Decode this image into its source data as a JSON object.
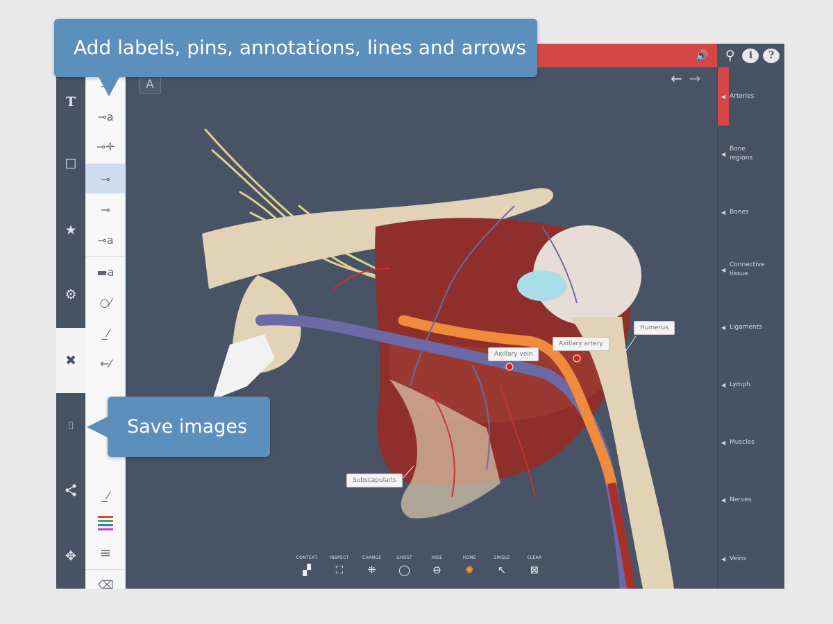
{
  "callouts": {
    "top": "Add labels, pins, annotations, lines and arrows",
    "bottom": "Save images"
  },
  "top_bar": {
    "accent_color": "#d54646",
    "icons": [
      "speaker-icon",
      "search-icon",
      "info-icon",
      "help-icon"
    ]
  },
  "left_rail": {
    "items": [
      {
        "icon": "text-icon",
        "glyph": "T"
      },
      {
        "icon": "square-icon",
        "glyph": "☐"
      },
      {
        "icon": "star-icon",
        "glyph": "★"
      },
      {
        "icon": "gear-icon",
        "glyph": "⚙"
      },
      {
        "icon": "annotation-tools-icon",
        "glyph": "✖",
        "active": true
      },
      {
        "icon": "camera-icon",
        "glyph": "📷"
      },
      {
        "icon": "share-icon",
        "glyph": "⋖"
      },
      {
        "icon": "move-icon",
        "glyph": "✥"
      }
    ]
  },
  "tools": {
    "items": [
      {
        "icon": "pin-remove-icon",
        "glyph": "⊸"
      },
      {
        "icon": "pin-label-icon",
        "glyph": "⊸a"
      },
      {
        "icon": "pin-move-icon",
        "glyph": "⊸✛"
      },
      {
        "icon": "pin-selected-icon",
        "glyph": "⊸",
        "selected": true
      },
      {
        "icon": "pin-delete-icon",
        "glyph": "⊸"
      },
      {
        "icon": "pin-text-icon",
        "glyph": "⊸a"
      },
      {
        "icon": "label-text-icon",
        "glyph": "▬a"
      },
      {
        "icon": "circle-line-icon",
        "glyph": "○⁄"
      },
      {
        "icon": "line-icon",
        "glyph": "_⁄"
      },
      {
        "icon": "arrow-line-icon",
        "glyph": "←⁄"
      },
      {
        "icon": "line-style-icon",
        "glyph": "_⁄"
      },
      {
        "icon": "color-palette-icon",
        "glyph": ""
      },
      {
        "icon": "line-weight-icon",
        "glyph": "≡"
      },
      {
        "icon": "eraser-icon",
        "glyph": "⌫"
      },
      {
        "icon": "lock-icon",
        "glyph": "🔓"
      }
    ],
    "palette_colors": [
      "#e04040",
      "#3fb34f",
      "#4a6fd8",
      "#c04ac0"
    ]
  },
  "font_button": "A",
  "nav": {
    "back": "←",
    "forward": "→"
  },
  "labels": [
    {
      "id": "axillary-vein",
      "text": "Axillary vein"
    },
    {
      "id": "axillary-artery",
      "text": "Axillary artery"
    },
    {
      "id": "humerus",
      "text": "Humerus"
    },
    {
      "id": "subscapularis",
      "text": "Subscapularis"
    }
  ],
  "bottom_bar": [
    {
      "label": "CONTEXT",
      "icon": "context-icon",
      "glyph": "▞"
    },
    {
      "label": "INSPECT",
      "icon": "inspect-icon",
      "glyph": "⛶"
    },
    {
      "label": "CHANGE",
      "icon": "change-icon",
      "glyph": "⁜"
    },
    {
      "label": "GHOST",
      "icon": "ghost-icon",
      "glyph": "◯"
    },
    {
      "label": "HIDE",
      "icon": "hide-icon",
      "glyph": "⊖"
    },
    {
      "label": "HOME",
      "icon": "home-icon",
      "glyph": "✺",
      "active": true
    },
    {
      "label": "SINGLE",
      "icon": "single-icon",
      "glyph": "↖"
    },
    {
      "label": "CLEAR",
      "icon": "clear-icon",
      "glyph": "⊠"
    }
  ],
  "right_panel": {
    "items": [
      "Arteries",
      "Bone regions",
      "Bones",
      "Connective tissue",
      "Ligaments",
      "Lymph",
      "Muscles",
      "Nerves",
      "Veins"
    ],
    "active": "Arteries"
  },
  "colors": {
    "background": "#485466",
    "callout": "#5d8fbd",
    "bone": "#e2d2b6",
    "muscle": "#8f2f2b",
    "vein": "#6b6aa6",
    "artery_highlight": "#f08a3c",
    "nerve": "#e3cf8f"
  }
}
